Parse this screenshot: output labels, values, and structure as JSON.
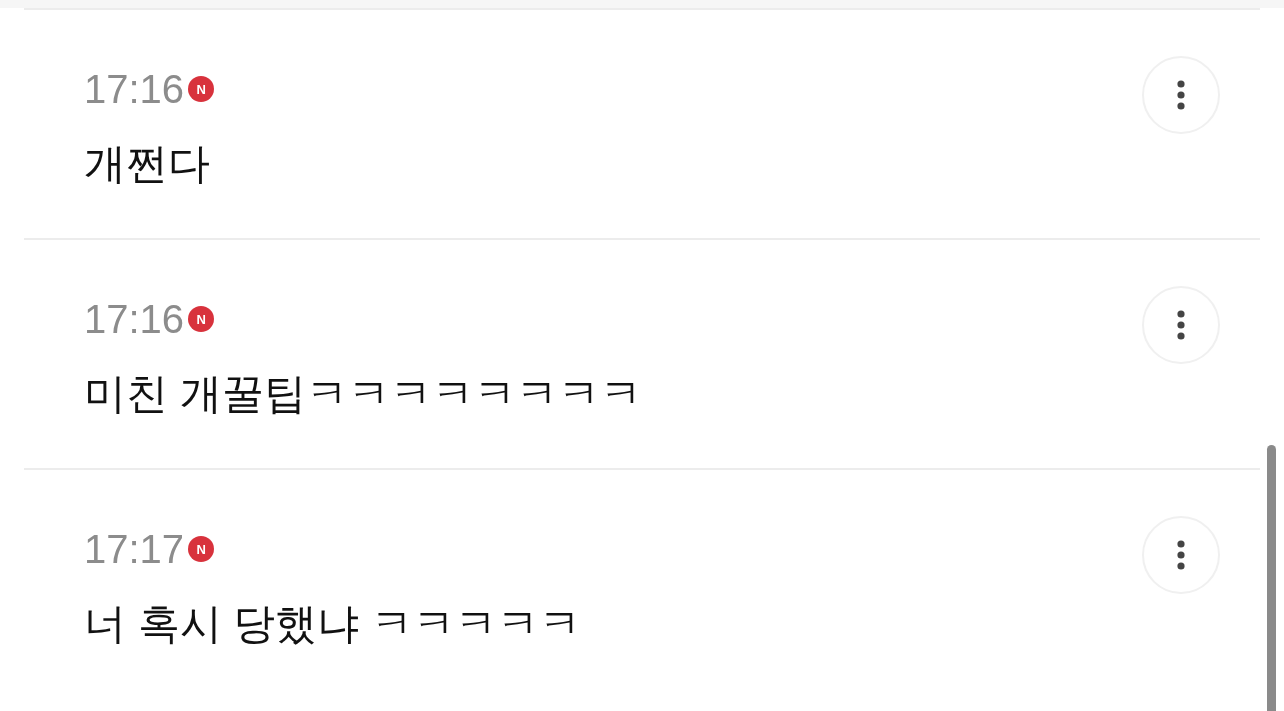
{
  "comments": [
    {
      "time": "17:16",
      "badge": "N",
      "text": "개쩐다"
    },
    {
      "time": "17:16",
      "badge": "N",
      "text": "미친 개꿀팁ㅋㅋㅋㅋㅋㅋㅋㅋ"
    },
    {
      "time": "17:17",
      "badge": "N",
      "text": "너 혹시 당했냐 ㅋㅋㅋㅋㅋ"
    }
  ]
}
